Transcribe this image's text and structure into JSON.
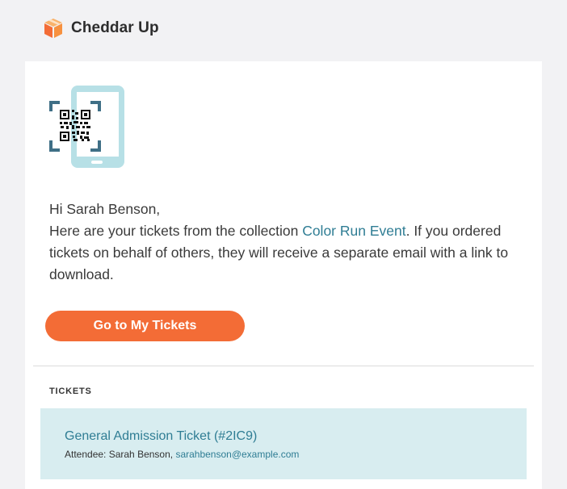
{
  "brand": {
    "name": "Cheddar Up"
  },
  "greeting": "Hi Sarah Benson,",
  "message": {
    "part1": "Here are your tickets from the collection ",
    "collection_link": "Color Run Event",
    "part2": ". If you ordered tickets on behalf of others, they will receive a separate email with a link to download."
  },
  "cta": {
    "label": "Go to My Tickets"
  },
  "tickets_section": {
    "label": "TICKETS",
    "items": [
      {
        "title": "General Admission Ticket (#2IC9)",
        "attendee_prefix": "Attendee: Sarah Benson, ",
        "email": "sarahbenson@example.com"
      }
    ]
  },
  "colors": {
    "accent": "#f36c36",
    "link": "#2f7d94",
    "ticket_bg": "#d8edf0",
    "qr_frame": "#3f6f86",
    "phone": "#b7e0e6"
  },
  "icons": {
    "logo": "cheddar-cube-logo-icon",
    "hero": "phone-qr-code-icon"
  }
}
